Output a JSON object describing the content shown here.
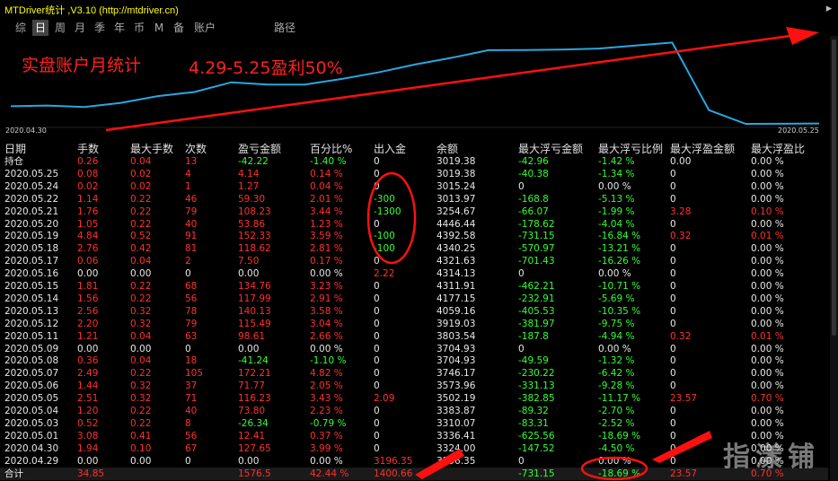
{
  "window": {
    "title": "MTDriver统计 ,V3.10 (http://mtdriver.cn)",
    "close_label": "▸"
  },
  "tabs": [
    "综",
    "日",
    "周",
    "月",
    "季",
    "年",
    "币",
    "M",
    "备",
    "账户",
    "路径"
  ],
  "active_tab": "日",
  "chart": {
    "title_note": "实盘账户月统计",
    "profit_note": "4.29-5.25盈利50%",
    "start_date": "2020.04.30",
    "end_date": "2020.05.25"
  },
  "chart_data": {
    "type": "line",
    "x": [
      "2020.04.30",
      "2020.05.01",
      "2020.05.03",
      "2020.05.04",
      "2020.05.05",
      "2020.05.06",
      "2020.05.07",
      "2020.05.08",
      "2020.05.09",
      "2020.05.11",
      "2020.05.12",
      "2020.05.13",
      "2020.05.14",
      "2020.05.15",
      "2020.05.16",
      "2020.05.17",
      "2020.05.18",
      "2020.05.19",
      "2020.05.20",
      "2020.05.21",
      "2020.05.22",
      "2020.05.24",
      "2020.05.25"
    ],
    "values": [
      3324.0,
      3336.41,
      3310.07,
      3383.87,
      3502.19,
      3573.96,
      3746.17,
      3704.93,
      3704.93,
      3803.54,
      3919.03,
      4059.16,
      4177.15,
      4311.91,
      4314.13,
      4321.63,
      4340.25,
      4392.58,
      4446.44,
      3254.67,
      3013.97,
      3015.24,
      3019.38
    ],
    "color": "#2aa7e0"
  },
  "table": {
    "headers": [
      "日期",
      "手数",
      "最大手数",
      "次数",
      "盈亏金额",
      "百分比%",
      "出入金",
      "余额",
      "最大浮亏金额",
      "最大浮亏比例",
      "最大浮盈金额",
      "最大浮盈比"
    ],
    "rows": [
      [
        "持仓",
        "0.26",
        "0.04",
        "13",
        "-42.22",
        "-1.40 %",
        "0",
        "3019.38",
        "-42.96",
        "-1.42 %",
        "0.00",
        "0.00 %"
      ],
      [
        "2020.05.25",
        "0.08",
        "0.02",
        "4",
        "4.14",
        "0.14 %",
        "0",
        "3019.38",
        "-40.38",
        "-1.34 %",
        "0",
        "0.00 %"
      ],
      [
        "2020.05.24",
        "0.02",
        "0.02",
        "1",
        "1.27",
        "0.04 %",
        "0",
        "3015.24",
        "0",
        "0.00 %",
        "0",
        "0.00 %"
      ],
      [
        "2020.05.22",
        "1.14",
        "0.22",
        "46",
        "59.30",
        "2.01 %",
        "-300",
        "3013.97",
        "-168.8",
        "-5.13 %",
        "0",
        "0.00 %"
      ],
      [
        "2020.05.21",
        "1.76",
        "0.22",
        "79",
        "108.23",
        "3.44 %",
        "-1300",
        "3254.67",
        "-66.07",
        "-1.99 %",
        "3.28",
        "0.10 %"
      ],
      [
        "2020.05.20",
        "1.05",
        "0.22",
        "40",
        "53.86",
        "1.23 %",
        "0",
        "4446.44",
        "-178.62",
        "-4.04 %",
        "0",
        "0.00 %"
      ],
      [
        "2020.05.19",
        "4.84",
        "0.52",
        "91",
        "152.33",
        "3.59 %",
        "-100",
        "4392.58",
        "-731.15",
        "-16.84 %",
        "0.32",
        "0.01 %"
      ],
      [
        "2020.05.18",
        "2.76",
        "0.42",
        "81",
        "118.62",
        "2.81 %",
        "-100",
        "4340.25",
        "-570.97",
        "-13.21 %",
        "0",
        "0.00 %"
      ],
      [
        "2020.05.17",
        "0.06",
        "0.04",
        "2",
        "7.50",
        "0.17 %",
        "0",
        "4321.63",
        "-701.43",
        "-16.26 %",
        "0",
        "0.00 %"
      ],
      [
        "2020.05.16",
        "0.00",
        "0.00",
        "0",
        "0.00",
        "0.00 %",
        "2.22",
        "4314.13",
        "0",
        "0.00 %",
        "0",
        "0.00 %"
      ],
      [
        "2020.05.15",
        "1.81",
        "0.22",
        "68",
        "134.76",
        "3.23 %",
        "0",
        "4311.91",
        "-462.21",
        "-10.71 %",
        "0",
        "0.00 %"
      ],
      [
        "2020.05.14",
        "1.56",
        "0.22",
        "56",
        "117.99",
        "2.91 %",
        "0",
        "4177.15",
        "-232.91",
        "-5.69 %",
        "0",
        "0.00 %"
      ],
      [
        "2020.05.13",
        "2.56",
        "0.32",
        "78",
        "140.13",
        "3.58 %",
        "0",
        "4059.16",
        "-405.53",
        "-10.35 %",
        "0",
        "0.00 %"
      ],
      [
        "2020.05.12",
        "2.20",
        "0.32",
        "79",
        "115.49",
        "3.04 %",
        "0",
        "3919.03",
        "-381.97",
        "-9.75 %",
        "0",
        "0.00 %"
      ],
      [
        "2020.05.11",
        "1.21",
        "0.04",
        "63",
        "98.61",
        "2.66 %",
        "0",
        "3803.54",
        "-187.8",
        "-4.94 %",
        "0.32",
        "0.01 %"
      ],
      [
        "2020.05.09",
        "0.00",
        "0.00",
        "0",
        "0.00",
        "0.00 %",
        "0",
        "3704.93",
        "0",
        "0.00 %",
        "0",
        "0.00 %"
      ],
      [
        "2020.05.08",
        "0.36",
        "0.04",
        "18",
        "-41.24",
        "-1.10 %",
        "0",
        "3704.93",
        "-49.59",
        "-1.32 %",
        "0",
        "0.00 %"
      ],
      [
        "2020.05.07",
        "2.49",
        "0.22",
        "105",
        "172.21",
        "4.82 %",
        "0",
        "3746.17",
        "-230.22",
        "-6.42 %",
        "0",
        "0.00 %"
      ],
      [
        "2020.05.06",
        "1.44",
        "0.32",
        "37",
        "71.77",
        "2.05 %",
        "0",
        "3573.96",
        "-331.13",
        "-9.28 %",
        "0",
        "0.00 %"
      ],
      [
        "2020.05.05",
        "2.51",
        "0.32",
        "71",
        "116.23",
        "3.43 %",
        "2.09",
        "3502.19",
        "-382.85",
        "-11.17 %",
        "23.57",
        "0.70 %"
      ],
      [
        "2020.05.04",
        "1.20",
        "0.22",
        "40",
        "73.80",
        "2.23 %",
        "0",
        "3383.87",
        "-89.32",
        "-2.70 %",
        "0",
        "0.00 %"
      ],
      [
        "2020.05.03",
        "0.52",
        "0.22",
        "8",
        "-26.34",
        "-0.79 %",
        "0",
        "3310.07",
        "-83.31",
        "-2.52 %",
        "0",
        "0.00 %"
      ],
      [
        "2020.05.01",
        "3.08",
        "0.41",
        "56",
        "12.41",
        "0.37 %",
        "0",
        "3336.41",
        "-625.56",
        "-18.69 %",
        "0",
        "0.00 %"
      ],
      [
        "2020.04.30",
        "1.94",
        "0.10",
        "67",
        "127.65",
        "3.99 %",
        "0",
        "3324.00",
        "-147.52",
        "-4.50 %",
        "0",
        "0.00 %"
      ],
      [
        "2020.04.29",
        "0.00",
        "0.00",
        "0",
        "0.00",
        "0.00 %",
        "3196.35",
        "3196.35",
        "0",
        "0.00 %",
        "0",
        "0.00 %"
      ]
    ],
    "total": [
      "合计",
      "34.85",
      "",
      "",
      "1576.5",
      "42.44 %",
      "1400.66",
      "",
      "-731.15",
      "-18.69 %",
      "23.57",
      "0.70 %"
    ]
  },
  "watermark": "指漾铺",
  "colors": {
    "positive": "#ff3030",
    "negative": "#33ff33",
    "neutral": "#e8e8e8",
    "annotation": "#ff1010"
  }
}
